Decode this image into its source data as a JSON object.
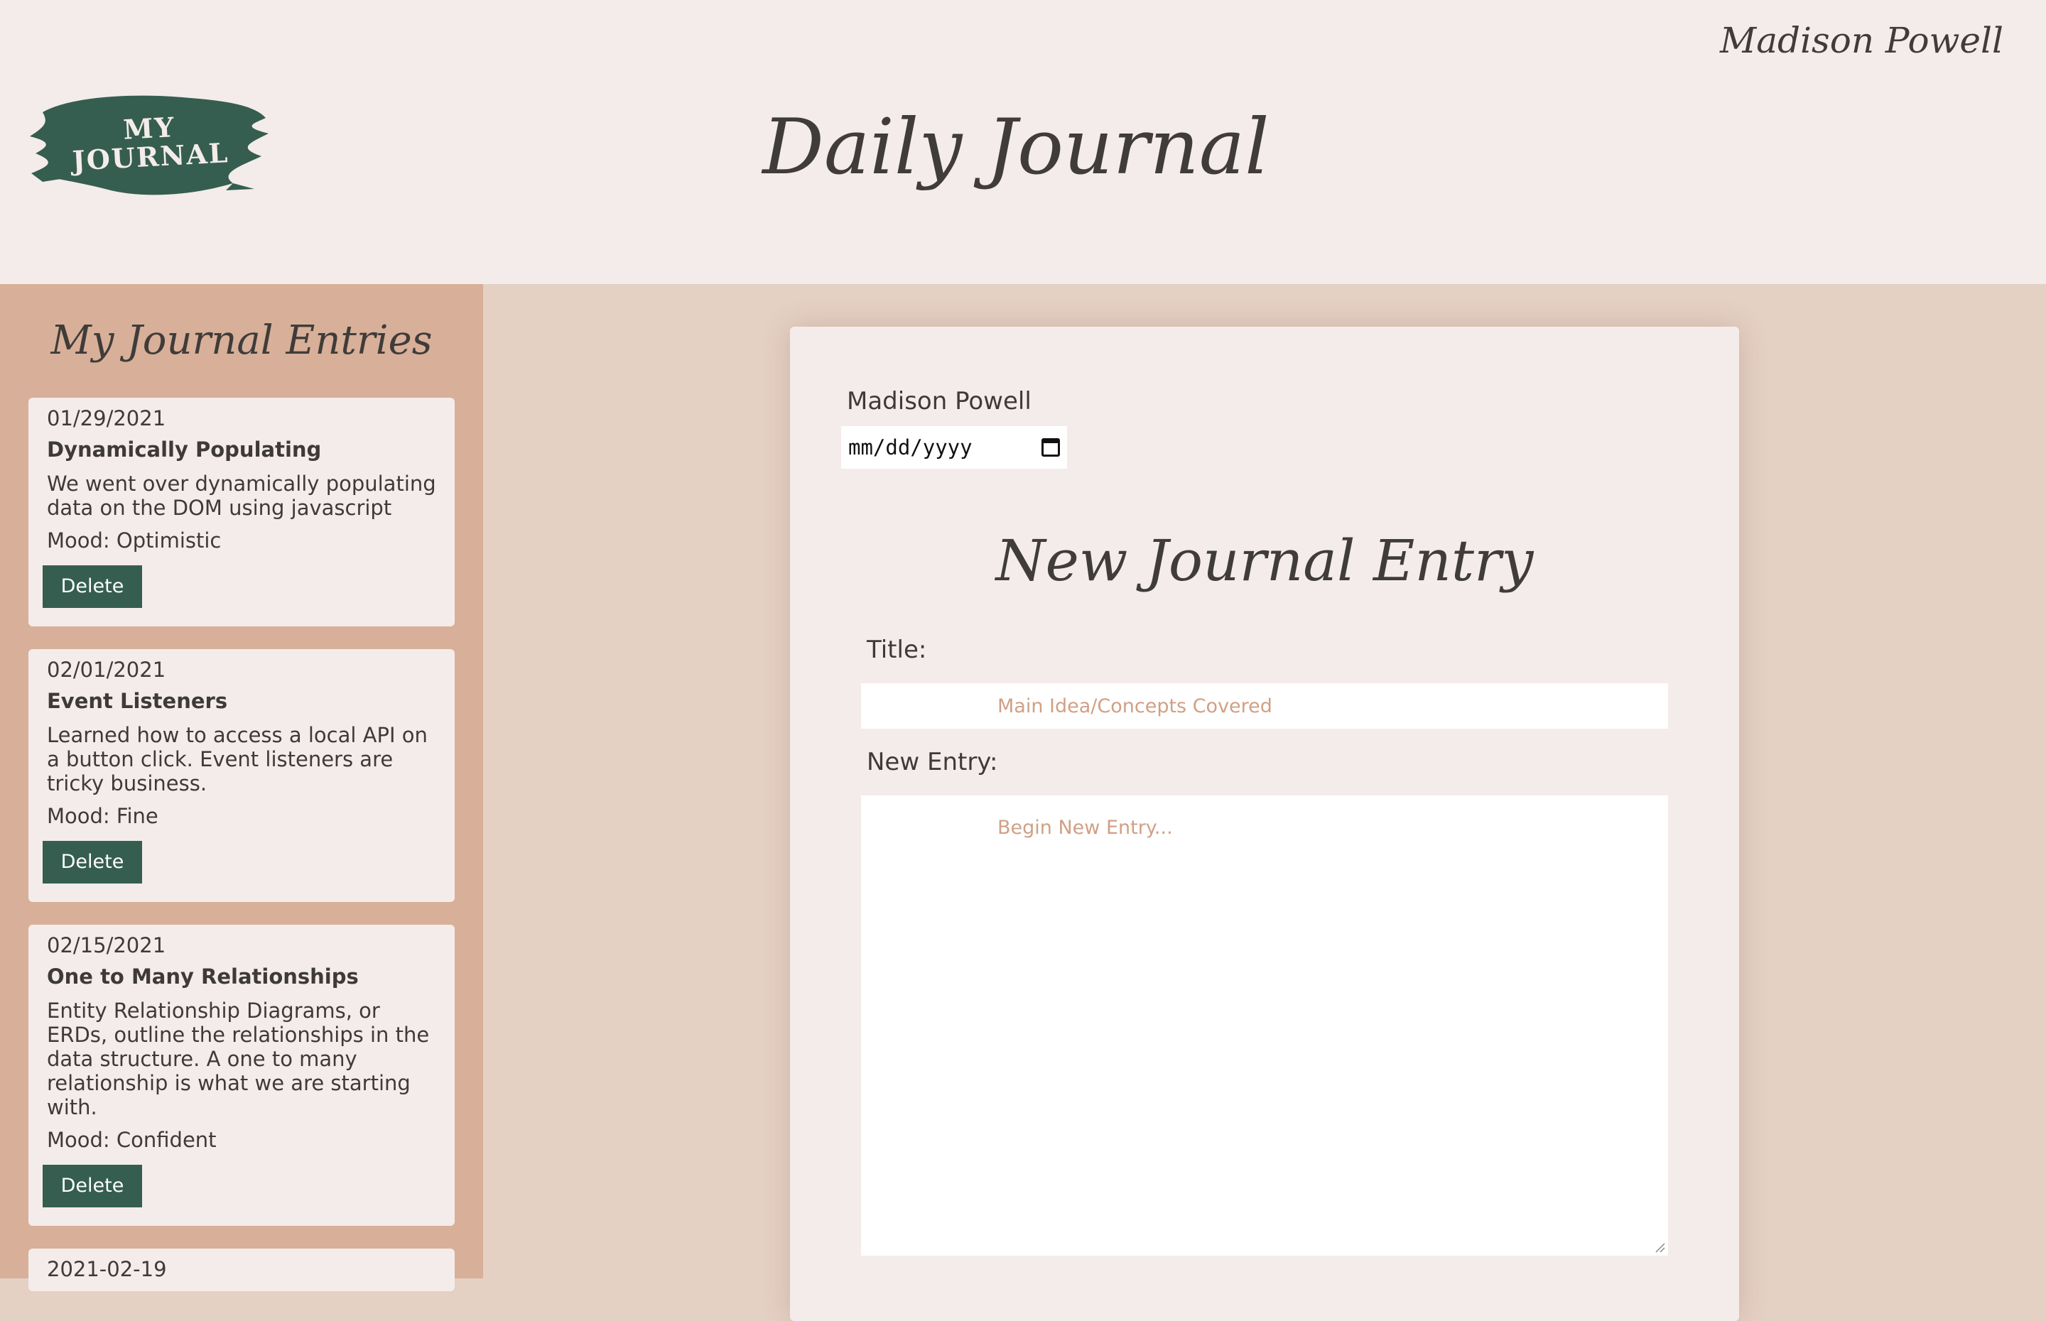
{
  "header": {
    "logo_line1": "MY",
    "logo_line2": "JOURNAL",
    "title": "Daily Journal",
    "user_name": "Madison Powell"
  },
  "sidebar": {
    "title": "My Journal Entries",
    "entries": [
      {
        "date": "01/29/2021",
        "title": "Dynamically Populating",
        "body": "We went over dynamically populating data on the DOM using javascript",
        "mood": "Mood: Optimistic",
        "delete_label": "Delete"
      },
      {
        "date": "02/01/2021",
        "title": "Event Listeners",
        "body": "Learned how to access a local API on a button click. Event listeners are tricky business.",
        "mood": "Mood: Fine",
        "delete_label": "Delete"
      },
      {
        "date": "02/15/2021",
        "title": "One to Many Relationships",
        "body": "Entity Relationship Diagrams, or ERDs, outline the relationships in the data structure. A one to many relationship is what we are starting with.",
        "mood": "Mood: Confident",
        "delete_label": "Delete"
      },
      {
        "date": "2021-02-19"
      }
    ]
  },
  "form": {
    "user_name": "Madison Powell",
    "date_placeholder": "mm/dd/yyyy",
    "title": "New Journal Entry",
    "title_label": "Title:",
    "title_placeholder": "Main Idea/Concepts Covered",
    "entry_label": "New Entry:",
    "entry_placeholder": "Begin New Entry..."
  },
  "colors": {
    "header_bg": "#f4ecea",
    "sidebar_bg": "#d8af98",
    "main_bg": "#e5d0c4",
    "accent_green": "#355e50",
    "placeholder": "#d0a085"
  },
  "icons": {
    "date_picker": "calendar-icon",
    "textarea_resize": "resize-grip-icon"
  }
}
